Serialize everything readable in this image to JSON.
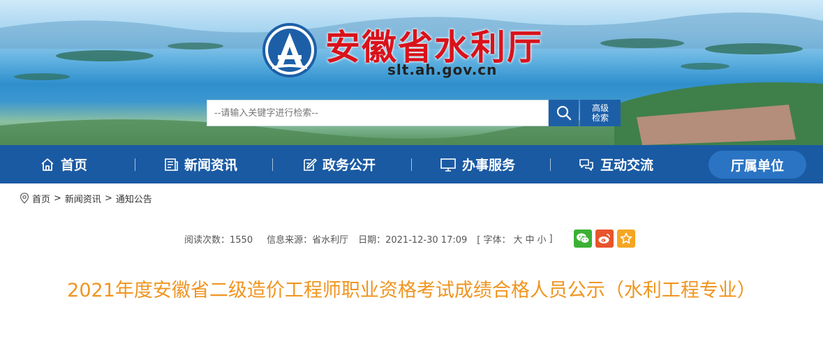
{
  "header": {
    "site_name": "安徽省水利厅",
    "site_domain": "slt.ah.gov.cn",
    "logo_letter": "A"
  },
  "search": {
    "placeholder": "--请输入关键字进行检索--",
    "advanced_label": "高级检索"
  },
  "nav": {
    "items": [
      {
        "label": "首页",
        "icon": "home-icon"
      },
      {
        "label": "新闻资讯",
        "icon": "news-icon"
      },
      {
        "label": "政务公开",
        "icon": "edit-icon"
      },
      {
        "label": "办事服务",
        "icon": "monitor-icon"
      },
      {
        "label": "互动交流",
        "icon": "chat-icon"
      },
      {
        "label": "厅属单位",
        "icon": ""
      }
    ]
  },
  "breadcrumb": {
    "items": [
      "首页",
      "新闻资讯",
      "通知公告"
    ],
    "separator": ">"
  },
  "meta": {
    "views": "阅读次数：1550",
    "source": "信息来源：省水利厅",
    "date": "日期：2021-12-30 17:09",
    "font_prefix": "[ 字体：",
    "font_large": "大",
    "font_medium": "中",
    "font_small": "小",
    "font_suffix": "]"
  },
  "share": {
    "icons": [
      "wechat-icon",
      "weibo-icon",
      "favorite-icon"
    ],
    "colors": {
      "wechat": "#3cb034",
      "weibo": "#e8542c",
      "favorite": "#f5a623"
    }
  },
  "article": {
    "title": "2021年度安徽省二级造价工程师职业资格考试成绩合格人员公示（水利工程专业）"
  },
  "colors": {
    "nav_bg": "#1a5aa3",
    "nav_pill": "#2a74c3",
    "brand_red": "#d9121b",
    "title_orange": "#f09520"
  }
}
